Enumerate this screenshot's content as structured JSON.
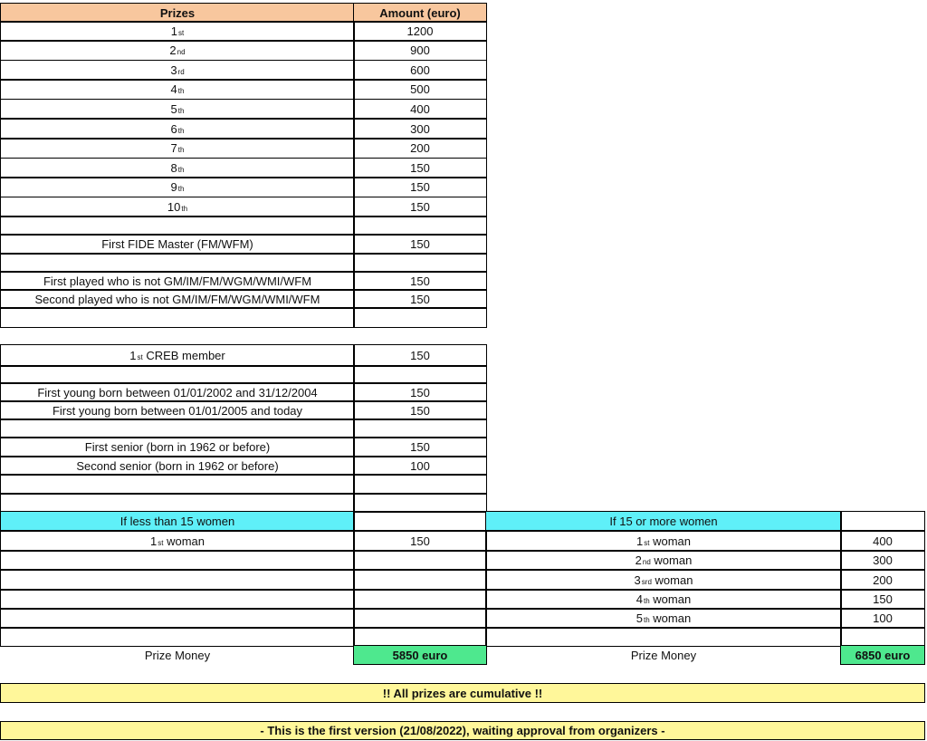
{
  "header": {
    "prizes": "Prizes",
    "amount": "Amount (euro)"
  },
  "ranks": [
    {
      "n": "1",
      "sup": "st",
      "amount": "1200"
    },
    {
      "n": "2",
      "sup": "nd",
      "amount": "900"
    },
    {
      "n": "3",
      "sup": "rd",
      "amount": "600"
    },
    {
      "n": "4",
      "sup": "th",
      "amount": "500"
    },
    {
      "n": "5",
      "sup": "th",
      "amount": "400"
    },
    {
      "n": "6",
      "sup": "th",
      "amount": "300"
    },
    {
      "n": "7",
      "sup": "th",
      "amount": "200"
    },
    {
      "n": "8",
      "sup": "th",
      "amount": "150"
    },
    {
      "n": "9",
      "sup": "th",
      "amount": "150"
    },
    {
      "n": "10",
      "sup": "th",
      "amount": "150"
    }
  ],
  "special": {
    "fm": {
      "label": "First FIDE Master (FM/WFM)",
      "amount": "150"
    },
    "first_not_titled": {
      "label": "First played who is not GM/IM/FM/WGM/WMI/WFM",
      "amount": "150"
    },
    "second_not_titled": {
      "label": "Second played who is not GM/IM/FM/WGM/WMI/WFM",
      "amount": "150"
    },
    "creb": {
      "n": "1",
      "sup": "st",
      "rest": "CREB member",
      "amount": "150"
    },
    "young1": {
      "label": "First young born between 01/01/2002 and 31/12/2004",
      "amount": "150"
    },
    "young2": {
      "label": "First young born between 01/01/2005 and today",
      "amount": "150"
    },
    "senior1": {
      "label": "First senior (born in 1962 or before)",
      "amount": "150"
    },
    "senior2": {
      "label": "Second senior (born in 1962 or before)",
      "amount": "100"
    }
  },
  "women_less": {
    "title": "If less than 15 women",
    "rows": [
      {
        "n": "1",
        "sup": "st",
        "rest": "woman",
        "amount": "150"
      }
    ],
    "total_label": "Prize Money",
    "total": "5850 euro"
  },
  "women_more": {
    "title": "If 15 or more women",
    "rows": [
      {
        "n": "1",
        "sup": "st",
        "rest": "woman",
        "amount": "400"
      },
      {
        "n": "2",
        "sup": "nd",
        "rest": "woman",
        "amount": "300"
      },
      {
        "n": "3",
        "sup": "srd",
        "rest": "woman",
        "amount": "200"
      },
      {
        "n": "4",
        "sup": "th",
        "rest": "woman",
        "amount": "150"
      },
      {
        "n": "5",
        "sup": "th",
        "rest": "woman",
        "amount": "100"
      }
    ],
    "total_label": "Prize Money",
    "total": "6850 euro"
  },
  "notes": {
    "cumulative": "!! All prizes are cumulative !!",
    "version": "- This is the first version (21/08/2022), waiting approval from organizers -"
  },
  "colors": {
    "header": "#f8c79e",
    "cyan": "#5ff0f8",
    "green": "#4ee88e",
    "yellow": "#fff79a"
  }
}
